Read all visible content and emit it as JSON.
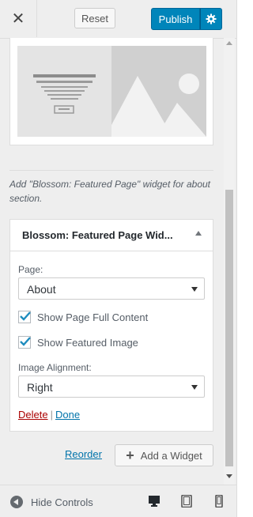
{
  "header": {
    "close_glyph": "✕",
    "reset_label": "Reset",
    "publish_label": "Publish",
    "publish_settings_icon": "gear-icon"
  },
  "preview": {
    "illustration": "widget-layout-preview"
  },
  "description": "Add \"Blossom: Featured Page\" widget for about section.",
  "widget": {
    "title": "Blossom: Featured Page Wid...",
    "page_label": "Page:",
    "page_value": "About",
    "show_full_content": {
      "label": "Show Page Full Content",
      "checked": true
    },
    "show_featured_image": {
      "label": "Show Featured Image",
      "checked": true
    },
    "alignment_label": "Image Alignment:",
    "alignment_value": "Right",
    "delete_label": "Delete",
    "separator": "|",
    "done_label": "Done"
  },
  "actions": {
    "reorder_label": "Reorder",
    "add_widget_label": "Add a Widget"
  },
  "footer": {
    "hide_controls_label": "Hide Controls",
    "devices": [
      "desktop-icon",
      "tablet-icon",
      "mobile-icon"
    ]
  },
  "colors": {
    "publish": "#0085ba",
    "link": "#0073aa",
    "delete": "#aa0000"
  }
}
